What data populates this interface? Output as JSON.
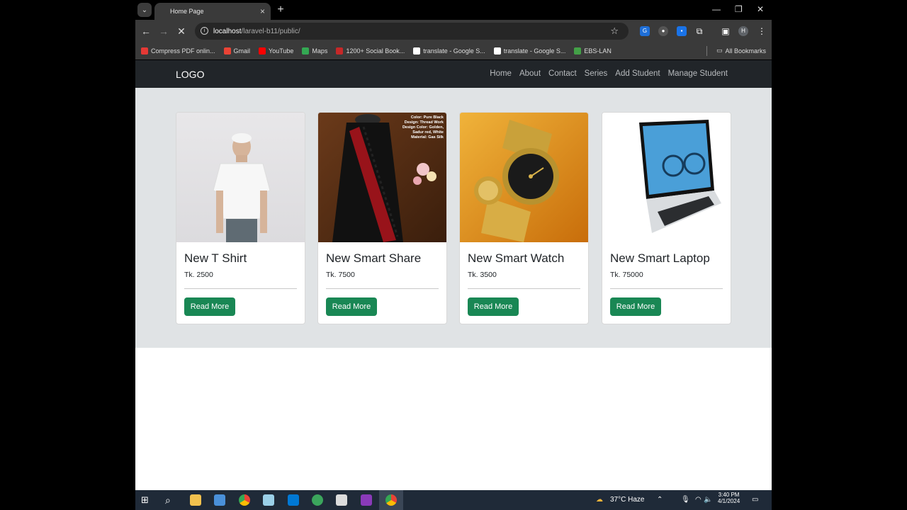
{
  "browser": {
    "tab_title": "Home Page",
    "url_host": "localhost",
    "url_path": "/laravel-b11/public/",
    "bookmarks": [
      {
        "label": "Compress PDF onlin...",
        "icon": "heart-icon",
        "color": "#e53935"
      },
      {
        "label": "Gmail",
        "icon": "gmail-icon",
        "color": "#ea4335"
      },
      {
        "label": "YouTube",
        "icon": "youtube-icon",
        "color": "#ff0000"
      },
      {
        "label": "Maps",
        "icon": "maps-icon",
        "color": "#34a853"
      },
      {
        "label": "1200+ Social Book...",
        "icon": "social-icon",
        "color": "#c62828"
      },
      {
        "label": "translate - Google S...",
        "icon": "google-icon",
        "color": "#ffffff"
      },
      {
        "label": "translate - Google S...",
        "icon": "google-icon",
        "color": "#ffffff"
      },
      {
        "label": "EBS-LAN",
        "icon": "ebs-icon",
        "color": "#43a047"
      }
    ],
    "all_bookmarks": "All Bookmarks",
    "profile_initial": "H"
  },
  "site": {
    "logo": "LOGO",
    "nav": [
      "Home",
      "About",
      "Contact",
      "Series",
      "Add Student",
      "Manage Student"
    ],
    "products": [
      {
        "title": "New T Shirt",
        "price": "Tk. 2500",
        "button": "Read More",
        "image": "white-tshirt-model"
      },
      {
        "title": "New Smart Share",
        "price": "Tk. 7500",
        "button": "Read More",
        "image": "black-red-saree",
        "image_text": "Color: Pure Black\nDesign: Thread Work\nDesign Color: Golden,\nSadur red, White\nMaterial: Gas Silk"
      },
      {
        "title": "New Smart Watch",
        "price": "Tk. 3500",
        "button": "Read More",
        "image": "gold-watch"
      },
      {
        "title": "New Smart Laptop",
        "price": "Tk. 75000",
        "button": "Read More",
        "image": "silver-laptop"
      }
    ],
    "colors": {
      "navbar": "#212529",
      "band": "#e0e3e5",
      "button": "#198754"
    }
  },
  "taskbar": {
    "weather": "37°C  Haze",
    "time": "3:40 PM",
    "date": "4/1/2024"
  }
}
